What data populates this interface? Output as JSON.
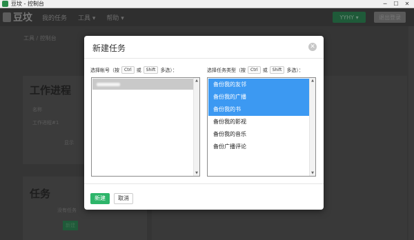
{
  "window": {
    "title": "豆坟 - 控制台"
  },
  "header": {
    "logo_text": "豆坟",
    "nav": [
      "我的任务",
      "工具 ▾",
      "帮助 ▾"
    ],
    "user_button": "YYHY ▾",
    "logout_button": "退出登录"
  },
  "background": {
    "breadcrumb": "工具 / 控制台",
    "card1": {
      "title": "工作进程",
      "col1": "名称",
      "row1": "工作进程#1",
      "more": "显示"
    },
    "card2": {
      "title": "任务",
      "empty_text": "没有任务",
      "button": "新建"
    }
  },
  "modal": {
    "title": "新建任务",
    "close_icon": "close-icon",
    "left": {
      "hint_prefix": "选择帐号（按",
      "key1": "Ctrl",
      "or": "或",
      "key2": "Shift",
      "hint_suffix": "多选）："
    },
    "right": {
      "hint_prefix": "选择任务类型（按",
      "key1": "Ctrl",
      "or": "或",
      "key2": "Shift",
      "hint_suffix": "多选）：",
      "items": [
        {
          "label": "备份我的友邻",
          "selected": true
        },
        {
          "label": "备份我的广播",
          "selected": true
        },
        {
          "label": "备份我的书",
          "selected": true
        },
        {
          "label": "备份我的影视",
          "selected": false
        },
        {
          "label": "备份我的音乐",
          "selected": false
        },
        {
          "label": "备份广播评论",
          "selected": false
        }
      ]
    },
    "new_button": "新建",
    "cancel_button": "取消"
  },
  "colors": {
    "accent_green": "#2db56a",
    "selected_blue": "#3c99f2"
  }
}
